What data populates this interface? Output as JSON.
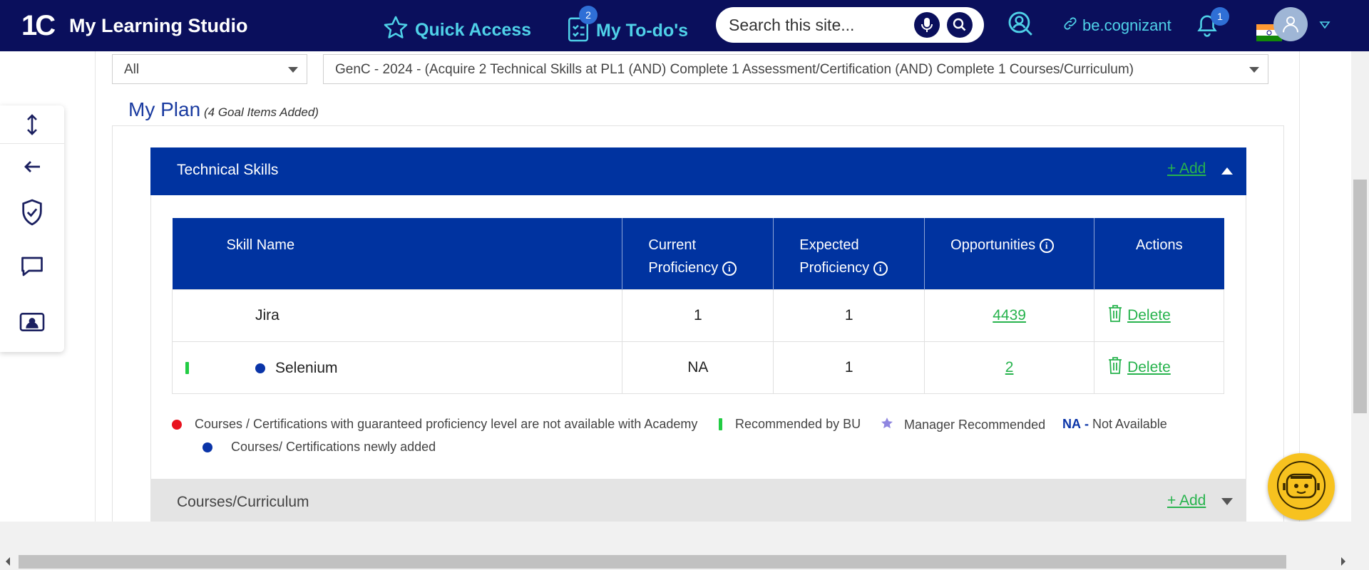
{
  "header": {
    "logo": "1C",
    "title": "My Learning Studio",
    "quick_access": "Quick Access",
    "todo": "My To-do's",
    "todo_badge": "2",
    "search_placeholder": "Search this site...",
    "link": "be.cognizant",
    "notif_badge": "1"
  },
  "filters": {
    "category": "All",
    "goal": "GenC - 2024 - (Acquire 2 Technical Skills at PL1 (AND) Complete 1 Assessment/Certification (AND) Complete 1 Courses/Curriculum)"
  },
  "plan": {
    "title": "My Plan",
    "subtitle": "(4 Goal Items Added)"
  },
  "technical_skills": {
    "title": "Technical Skills",
    "add_label": "+ Add",
    "columns": {
      "skill": "Skill Name",
      "current_1": "Current",
      "current_2": "Proficiency",
      "expected_1": "Expected",
      "expected_2": "Proficiency",
      "opportunities": "Opportunities",
      "actions": "Actions"
    },
    "rows": [
      {
        "skill": "Jira",
        "current": "1",
        "expected": "1",
        "opportunities": "4439",
        "action": "Delete"
      },
      {
        "skill": "Selenium",
        "current": "NA",
        "expected": "1",
        "opportunities": "2",
        "action": "Delete"
      }
    ]
  },
  "legend": {
    "red": "Courses / Certifications with guaranteed proficiency level are not available with Academy",
    "green": "Recommended by BU",
    "star": "Manager Recommended",
    "na_key": "NA",
    "na_dash": "-",
    "na": "Not Available",
    "blue": "Courses/ Certifications newly added"
  },
  "courses": {
    "title": "Courses/Curriculum",
    "add_label": "+ Add"
  },
  "colors": {
    "nav_bg": "#0a0f5c",
    "accent_cyan": "#4fd1e8",
    "section_blue": "#0033a0",
    "link_green": "#27b34d"
  }
}
